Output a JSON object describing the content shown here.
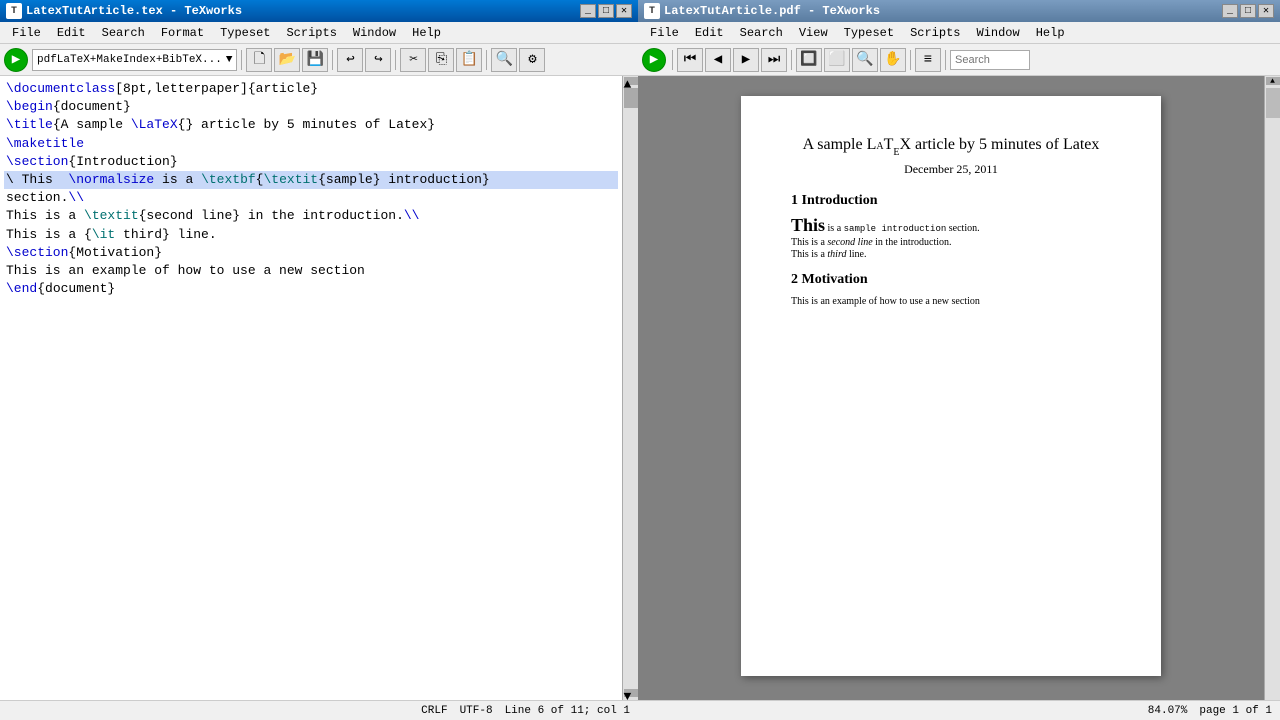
{
  "leftWindow": {
    "title": "LatexTutArticle.tex - TeXworks",
    "titlebarActive": true,
    "menus": [
      "File",
      "Edit",
      "Search",
      "Format",
      "Typeset",
      "Scripts",
      "Window",
      "Help"
    ],
    "compileDropdown": "pdfLaTeX+MakeIndex+BibTeX...",
    "editorLines": [
      {
        "id": 1,
        "text": "\\documentclass[8pt,letterpaper]{article}",
        "highlighted": false
      },
      {
        "id": 2,
        "text": "\\begin{document}",
        "highlighted": false
      },
      {
        "id": 3,
        "text": "\\title{A sample \\LaTeX{} article by 5 minutes of Latex}",
        "highlighted": false
      },
      {
        "id": 4,
        "text": "\\maketitle",
        "highlighted": false
      },
      {
        "id": 5,
        "text": "\\section{Introduction}",
        "highlighted": false
      },
      {
        "id": 6,
        "text": "\\ This  \\normalsize is a \\textbf{\\textit{sample} introduction}",
        "highlighted": true
      },
      {
        "id": 7,
        "text": "section.\\\\",
        "highlighted": false
      },
      {
        "id": 8,
        "text": "This is a \\textit{second line} in the introduction.\\\\",
        "highlighted": false
      },
      {
        "id": 9,
        "text": "This is a {\\it third} line.",
        "highlighted": false
      },
      {
        "id": 10,
        "text": "\\section{Motivation}",
        "highlighted": false
      },
      {
        "id": 11,
        "text": "This is an example of how to use a new section",
        "highlighted": false
      },
      {
        "id": 12,
        "text": "\\end{document}",
        "highlighted": false
      }
    ],
    "statusbar": {
      "encoding": "CRLF",
      "charset": "UTF-8",
      "position": "Line 6 of 11; col 1"
    }
  },
  "rightWindow": {
    "title": "LatexTutArticle.pdf - TeXworks",
    "menus": [
      "File",
      "Edit",
      "Search",
      "View",
      "Typeset",
      "Scripts",
      "Window",
      "Help"
    ],
    "searchLabel": "Search",
    "pdf": {
      "title": "A sample LᴀTᴇX article by 5 minutes of Latex",
      "date": "December 25, 2011",
      "section1": "1   Introduction",
      "intro_large": "This",
      "intro_small1": "is a",
      "intro_mono": "sample introduction",
      "intro_small2": "section.",
      "intro_line2": "This is a second line in the introduction.",
      "intro_line3": "This is a third line.",
      "section2": "2   Motivation",
      "motivation": "This is an example of how to use a new section"
    },
    "statusbar": {
      "zoom": "84.07%",
      "page": "page 1 of 1"
    }
  },
  "icons": {
    "new": "🗋",
    "open": "📂",
    "save": "💾",
    "undo": "↩",
    "redo": "↪",
    "cut": "✂",
    "copy": "⎘",
    "paste": "📋",
    "search": "🔍",
    "settings": "⚙"
  }
}
